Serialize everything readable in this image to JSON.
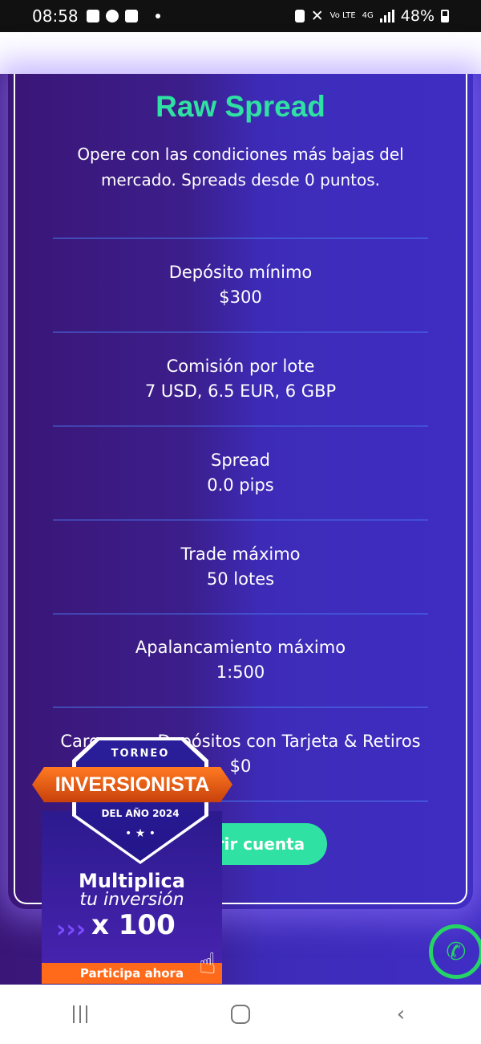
{
  "status_bar": {
    "time": "08:58",
    "network": "4G",
    "volte": "Vo LTE",
    "battery": "48%"
  },
  "card": {
    "title": "Raw Spread",
    "subtitle": "Opere con las condiciones más bajas del mercado. Spreads desde 0 puntos.",
    "rows": [
      {
        "label": "Depósito mínimo",
        "value": "$300"
      },
      {
        "label": "Comisión por lote",
        "value": "7 USD, 6.5 EUR, 6 GBP"
      },
      {
        "label": "Spread",
        "value": "0.0 pips"
      },
      {
        "label": "Trade máximo",
        "value": "50 lotes"
      },
      {
        "label": "Apalancamiento máximo",
        "value": "1:500"
      },
      {
        "label": "Cargos por Depósitos con Tarjeta & Retiros",
        "value": "$0"
      }
    ],
    "cta_label": "Abrir cuenta"
  },
  "promo": {
    "torneo": "TORNEO",
    "inversionista": "INVERSIONISTA",
    "del_ano": "DEL AÑO 2024",
    "multiplica": "Multiplica",
    "tu_inversion": "tu inversión",
    "x100": "x 100",
    "participa": "Participa ahora"
  },
  "icons": {
    "whatsapp": "whatsapp-icon",
    "nav_recents": "recents-icon",
    "nav_home": "home-icon",
    "nav_back": "back-icon"
  }
}
